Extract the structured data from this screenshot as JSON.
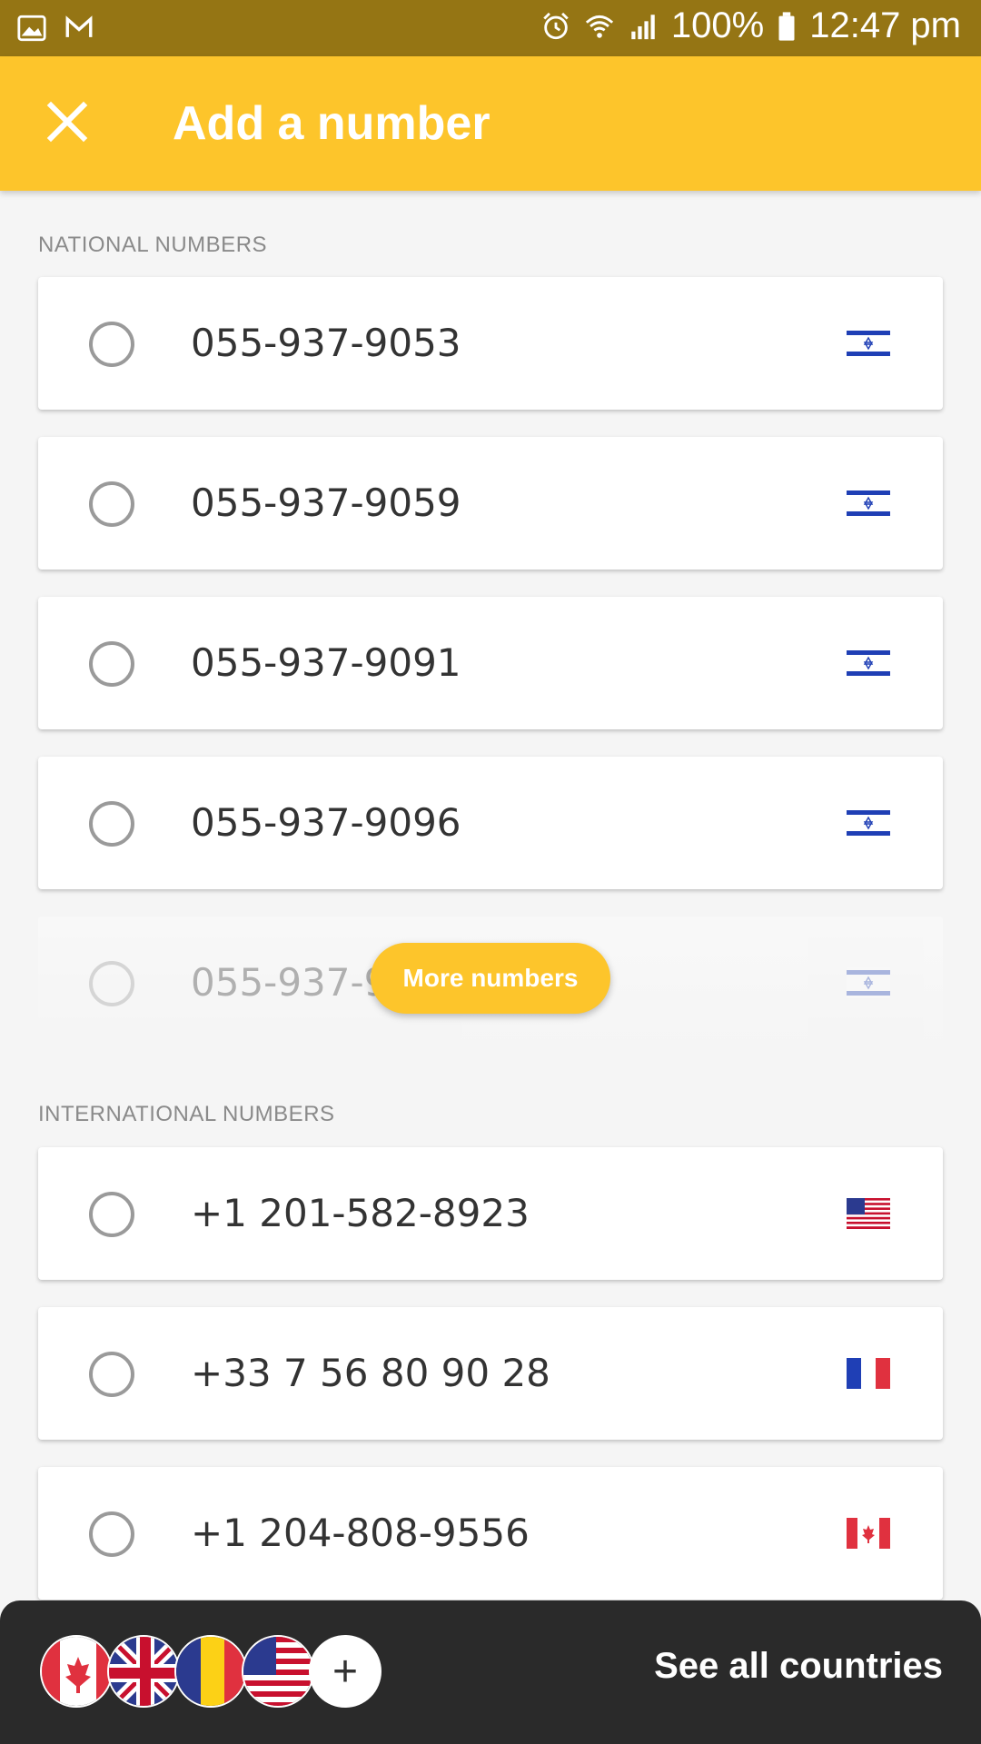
{
  "status_bar": {
    "battery": "100%",
    "time": "12:47 pm",
    "icons": [
      "gallery-icon",
      "gmail-icon",
      "alarm-icon",
      "wifi-icon",
      "signal-icon",
      "battery-icon"
    ]
  },
  "app_bar": {
    "title": "Add a number",
    "close_icon": "close-icon"
  },
  "national": {
    "label": "NATIONAL NUMBERS",
    "items": [
      {
        "number": "055-937-9053",
        "flag": "israel-flag-icon"
      },
      {
        "number": "055-937-9059",
        "flag": "israel-flag-icon"
      },
      {
        "number": "055-937-9091",
        "flag": "israel-flag-icon"
      },
      {
        "number": "055-937-9096",
        "flag": "israel-flag-icon"
      },
      {
        "number": "055-937-9",
        "flag": "israel-flag-icon"
      }
    ],
    "more_button": "More numbers"
  },
  "international": {
    "label": "INTERNATIONAL NUMBERS",
    "items": [
      {
        "number": "+1 201-582-8923",
        "flag": "usa-flag-icon"
      },
      {
        "number": "+33 7 56 80 90 28",
        "flag": "france-flag-icon"
      },
      {
        "number": "+1 204-808-9556",
        "flag": "canada-flag-icon"
      }
    ]
  },
  "bottom_bar": {
    "flags": [
      "canada-flag-icon",
      "uk-flag-icon",
      "romania-flag-icon",
      "usa-flag-icon",
      "plus-icon"
    ],
    "plus": "+",
    "see_all": "See all countries"
  },
  "colors": {
    "status_bar": "#957514",
    "accent": "#fdc52b",
    "bottom_bar": "#2a2a2a",
    "background": "#f5f5f5"
  }
}
